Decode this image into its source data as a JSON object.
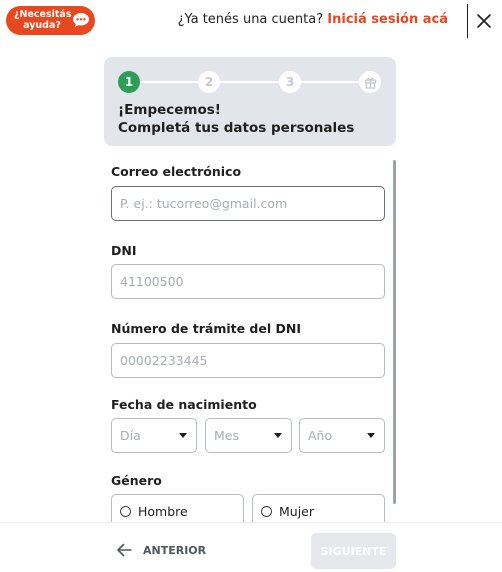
{
  "header": {
    "help_label": "¿Necesitás ayuda?",
    "account_question": "¿Ya tenés una cuenta?",
    "login_link": "Iniciá sesión acá",
    "accent_color": "#e8481f"
  },
  "steps": {
    "items": [
      {
        "label": "1",
        "state": "active"
      },
      {
        "label": "2",
        "state": "pending"
      },
      {
        "label": "3",
        "state": "pending"
      },
      {
        "label": "",
        "icon": "gift-icon",
        "state": "pending"
      }
    ],
    "title_line1": "¡Empecemos!",
    "title_line2": "Completá tus datos personales",
    "active_color": "#2d9e5a"
  },
  "form": {
    "email": {
      "label": "Correo electrónico",
      "placeholder": "P. ej.: tucorreo@gmail.com",
      "value": ""
    },
    "dni": {
      "label": "DNI",
      "placeholder": "41100500",
      "value": ""
    },
    "tramite": {
      "label": "Número de trámite del DNI",
      "placeholder": "00002233445",
      "value": ""
    },
    "birthdate": {
      "label": "Fecha de nacimiento",
      "day": "Día",
      "month": "Mes",
      "year": "Año"
    },
    "gender": {
      "label": "Género",
      "options": [
        "Hombre",
        "Mujer"
      ]
    }
  },
  "footer": {
    "back_label": "ANTERIOR",
    "next_label": "SIGUIENTE",
    "next_enabled": false
  }
}
